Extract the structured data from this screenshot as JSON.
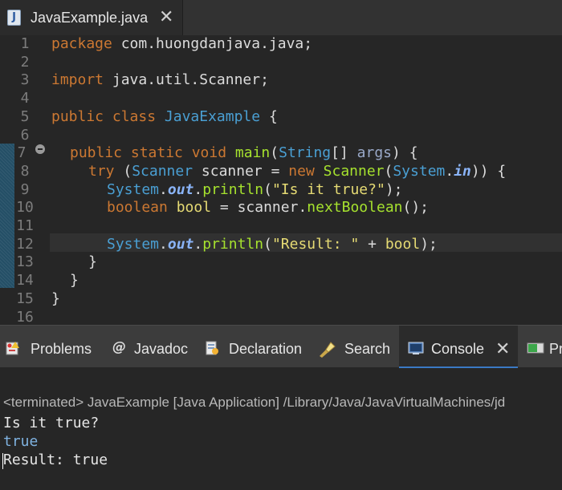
{
  "editor_tab": {
    "icon": "java-file-icon",
    "icon_glyph": "J",
    "label": "JavaExample.java",
    "close": "✕"
  },
  "line_numbers": [
    "1",
    "2",
    "3",
    "4",
    "5",
    "6",
    "7",
    "8",
    "9",
    "10",
    "11",
    "12",
    "13",
    "14",
    "15",
    "16"
  ],
  "code": {
    "l1": {
      "kw": "package",
      "rest": " com.huongdanjava.java;"
    },
    "l3": {
      "kw": "import",
      "rest": " java.util.Scanner;"
    },
    "l5": {
      "kw": "public class",
      "cls": "JavaExample",
      "rest": " {"
    },
    "l7": {
      "kw": "public static void",
      "fn": "main",
      "p1": "(",
      "ty": "String",
      "p2": "[] ",
      "param": "args",
      "p3": ") {"
    },
    "l8": {
      "kw": "try",
      "p1": " (",
      "ty": "Scanner",
      "sp": " ",
      "var": "scanner",
      "eq": " = ",
      "kw2": "new",
      "sp2": " ",
      "fn": "Scanner",
      "p2": "(",
      "sys": "System",
      "dot": ".",
      "fld": "in",
      "p3": ")) {"
    },
    "l9": {
      "sys": "System",
      "dot": ".",
      "fld": "out",
      "dot2": ".",
      "fn": "println",
      "p1": "(",
      "str": "\"Is it true?\"",
      "p2": ");"
    },
    "l10": {
      "kw": "boolean",
      "sp": " ",
      "var": "bool",
      "eq": " = ",
      "obj": "scanner",
      "dot": ".",
      "fn": "nextBoolean",
      "p": "();"
    },
    "l12": {
      "sys": "System",
      "dot": ".",
      "fld": "out",
      "dot2": ".",
      "fn": "println",
      "p1": "(",
      "str": "\"Result: \"",
      "plus": " + ",
      "var": "bool",
      "p2": ");"
    },
    "l13": "}",
    "l14": "}",
    "l15": "}"
  },
  "view_tabs": [
    {
      "label": "Problems",
      "icon": "problems-icon",
      "active": false
    },
    {
      "label": "Javadoc",
      "icon": "at-sign-icon",
      "active": false
    },
    {
      "label": "Declaration",
      "icon": "declaration-icon",
      "active": false
    },
    {
      "label": "Search",
      "icon": "flashlight-icon",
      "active": false
    },
    {
      "label": "Console",
      "icon": "console-icon",
      "active": true,
      "close": "✕"
    },
    {
      "label": "Pr",
      "icon": "progress-icon",
      "active": false
    }
  ],
  "console": {
    "status": "<terminated> JavaExample [Java Application] /Library/Java/JavaVirtualMachines/jd",
    "lines": [
      "Is it true?",
      "true",
      "Result: true"
    ],
    "colors": {
      "stdout": "#e6e6e6",
      "stdin": "#7fb2e0"
    }
  }
}
